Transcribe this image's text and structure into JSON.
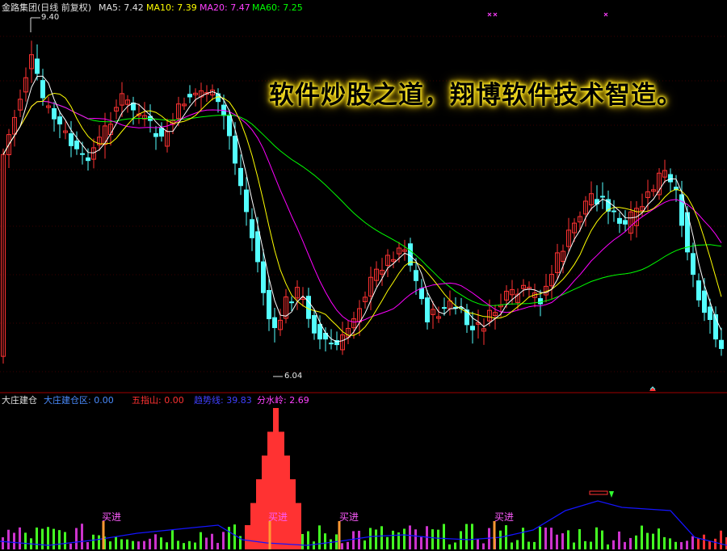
{
  "header": {
    "title": "金路集团(日线 前复权)",
    "ma5": "MA5: 7.42",
    "ma10": "MA10: 7.39",
    "ma20": "MA20: 7.47",
    "ma60": "MA60: 7.25"
  },
  "banner": "软件炒股之道，翔博软件技术智造。",
  "annotations": {
    "high": "9.40",
    "low": "6.04"
  },
  "indicator": {
    "name": "大庄建仓",
    "zone": "大庄建仓区: 0.00",
    "wuzhishan": "五指山: 0.00",
    "trend": "趋势线: 39.83",
    "fenshuiling": "分水岭: 2.69"
  },
  "buy_label": "买进",
  "colors": {
    "up": "#ff3232",
    "down": "#54ffff",
    "ma5": "#ffffff",
    "ma10": "#ffff00",
    "ma20": "#ff00ff",
    "ma60": "#00ff00",
    "trend": "#1414ff",
    "buy_signal": "#ff9933"
  }
}
